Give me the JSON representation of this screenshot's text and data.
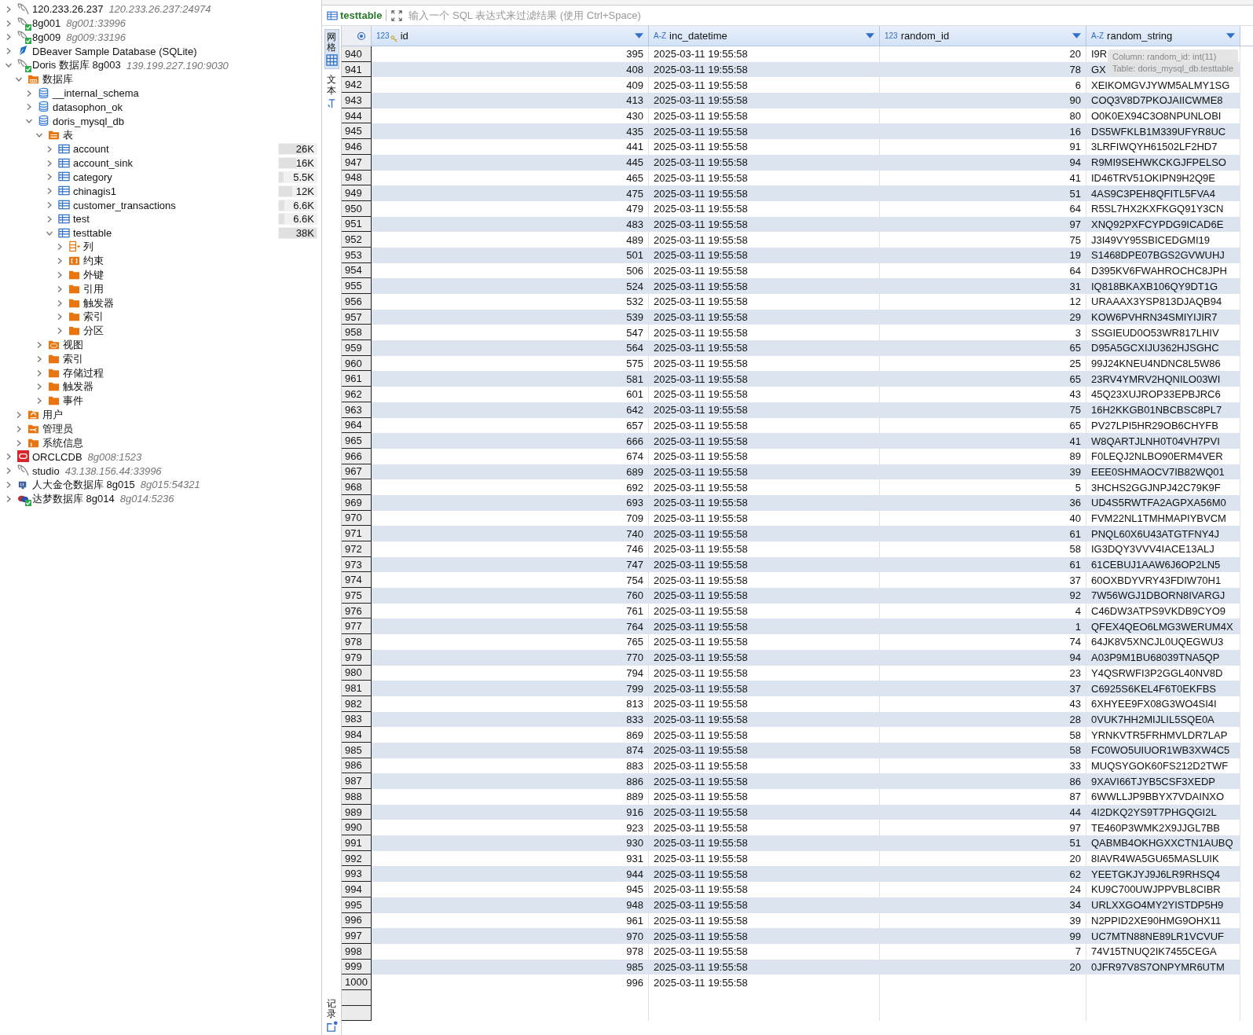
{
  "tree": [
    {
      "label": "120.233.26.237",
      "detail": "120.233.26.237:24974",
      "kind": "server",
      "connected": false,
      "expanded": false
    },
    {
      "label": "8g001",
      "detail": "8g001:33996",
      "kind": "server",
      "connected": true,
      "expanded": false
    },
    {
      "label": "8g009",
      "detail": "8g009:33196",
      "kind": "server",
      "connected": true,
      "expanded": false
    },
    {
      "label": "DBeaver Sample Database (SQLite)",
      "kind": "sqlite",
      "connected": false,
      "expanded": false
    },
    {
      "label": "Doris 数据库 8g003",
      "detail": "139.199.227.190:9030",
      "kind": "server",
      "connected": true,
      "expanded": true,
      "children": [
        {
          "label": "数据库",
          "kind": "databases",
          "expanded": true,
          "children": [
            {
              "label": "__internal_schema",
              "kind": "schema",
              "expanded": false
            },
            {
              "label": "datasophon_ok",
              "kind": "schema",
              "expanded": false
            },
            {
              "label": "doris_mysql_db",
              "kind": "schema",
              "expanded": true,
              "children": [
                {
                  "label": "表",
                  "kind": "tables",
                  "expanded": true,
                  "children": [
                    {
                      "label": "account",
                      "kind": "table",
                      "expanded": false,
                      "size": "26K",
                      "level": 0.7
                    },
                    {
                      "label": "account_sink",
                      "kind": "table",
                      "expanded": false,
                      "size": "16K",
                      "level": 0.45
                    },
                    {
                      "label": "category",
                      "kind": "table",
                      "expanded": false,
                      "size": "5.5K",
                      "level": 0.12
                    },
                    {
                      "label": "chinagis1",
                      "kind": "table",
                      "expanded": false,
                      "size": "12K",
                      "level": 0.35
                    },
                    {
                      "label": "customer_transactions",
                      "kind": "table",
                      "expanded": false,
                      "size": "6.6K",
                      "level": 0.15
                    },
                    {
                      "label": "test",
                      "kind": "table",
                      "expanded": false,
                      "size": "6.6K",
                      "level": 0.15
                    },
                    {
                      "label": "testtable",
                      "kind": "table",
                      "expanded": true,
                      "size": "38K",
                      "level": 1,
                      "children": [
                        {
                          "label": "列",
                          "kind": "columns",
                          "expanded": false
                        },
                        {
                          "label": "约束",
                          "kind": "constraints",
                          "expanded": false
                        },
                        {
                          "label": "外键",
                          "kind": "folder",
                          "expanded": false
                        },
                        {
                          "label": "引用",
                          "kind": "folder",
                          "expanded": false
                        },
                        {
                          "label": "触发器",
                          "kind": "folder",
                          "expanded": false
                        },
                        {
                          "label": "索引",
                          "kind": "folder",
                          "expanded": false
                        },
                        {
                          "label": "分区",
                          "kind": "folder",
                          "expanded": false
                        }
                      ]
                    }
                  ]
                },
                {
                  "label": "视图",
                  "kind": "views",
                  "expanded": false
                },
                {
                  "label": "索引",
                  "kind": "folder",
                  "expanded": false
                },
                {
                  "label": "存储过程",
                  "kind": "folder",
                  "expanded": false
                },
                {
                  "label": "触发器",
                  "kind": "folder",
                  "expanded": false
                },
                {
                  "label": "事件",
                  "kind": "folder",
                  "expanded": false
                }
              ]
            }
          ]
        },
        {
          "label": "用户",
          "kind": "users",
          "expanded": false
        },
        {
          "label": "管理员",
          "kind": "admins",
          "expanded": false
        },
        {
          "label": "系统信息",
          "kind": "info",
          "expanded": false
        }
      ]
    },
    {
      "label": "ORCLCDB",
      "detail": "8g008:1523",
      "kind": "oracle",
      "connected": false,
      "expanded": false
    },
    {
      "label": "studio",
      "detail": "43.138.156.44:33996",
      "kind": "server",
      "connected": false,
      "expanded": false
    },
    {
      "label": "人大金仓数据库 8g015",
      "detail": "8g015:54321",
      "kind": "kingbase",
      "connected": false,
      "expanded": false
    },
    {
      "label": "达梦数据库 8g014",
      "detail": "8g014:5236",
      "kind": "dameng",
      "connected": true,
      "expanded": false
    }
  ],
  "filter": {
    "table": "testtable",
    "placeholder": "输入一个 SQL 表达式来过滤结果 (使用 Ctrl+Space)"
  },
  "side_tabs": [
    {
      "label": "网格",
      "kind": "grid",
      "selected": true
    },
    {
      "label": "文本",
      "kind": "text",
      "selected": false
    }
  ],
  "record_tab": {
    "label": "记录"
  },
  "columns": [
    {
      "type": "123",
      "name": "id",
      "key": true
    },
    {
      "type": "A-Z",
      "name": "inc_datetime",
      "key": false
    },
    {
      "type": "123",
      "name": "random_id",
      "key": false
    },
    {
      "type": "A-Z",
      "name": "random_string",
      "key": false
    }
  ],
  "rows": [
    {
      "row": "940",
      "id": "395",
      "datetime": "2025-03-11 19:55:58",
      "random_id": "20",
      "random_string": "I9R"
    },
    {
      "row": "941",
      "id": "408",
      "datetime": "2025-03-11 19:55:58",
      "random_id": "78",
      "random_string": "GX"
    },
    {
      "row": "942",
      "id": "409",
      "datetime": "2025-03-11 19:55:58",
      "random_id": "6",
      "random_string": "XEIKOMGVJYWM5ALMY1SG"
    },
    {
      "row": "943",
      "id": "413",
      "datetime": "2025-03-11 19:55:58",
      "random_id": "90",
      "random_string": "COQ3V8D7PKOJAIICWME8"
    },
    {
      "row": "944",
      "id": "430",
      "datetime": "2025-03-11 19:55:58",
      "random_id": "80",
      "random_string": "O0K0EX94C3O8NPUNLOBI"
    },
    {
      "row": "945",
      "id": "435",
      "datetime": "2025-03-11 19:55:58",
      "random_id": "16",
      "random_string": "DS5WFKLB1M339UFYR8UC"
    },
    {
      "row": "946",
      "id": "441",
      "datetime": "2025-03-11 19:55:58",
      "random_id": "91",
      "random_string": "3LRFIWQYH61502LF2HD7"
    },
    {
      "row": "947",
      "id": "445",
      "datetime": "2025-03-11 19:55:58",
      "random_id": "94",
      "random_string": "R9MI9SEHWKCKGJFPELSO"
    },
    {
      "row": "948",
      "id": "465",
      "datetime": "2025-03-11 19:55:58",
      "random_id": "41",
      "random_string": "ID46TRV51OKIPN9H2Q9E"
    },
    {
      "row": "949",
      "id": "475",
      "datetime": "2025-03-11 19:55:58",
      "random_id": "51",
      "random_string": "4AS9C3PEH8QFITL5FVA4"
    },
    {
      "row": "950",
      "id": "479",
      "datetime": "2025-03-11 19:55:58",
      "random_id": "64",
      "random_string": "R5SL7HX2KXFKGQ91Y3CN"
    },
    {
      "row": "951",
      "id": "483",
      "datetime": "2025-03-11 19:55:58",
      "random_id": "97",
      "random_string": "XNQ92PXFCYPDG9ICAD6E"
    },
    {
      "row": "952",
      "id": "489",
      "datetime": "2025-03-11 19:55:58",
      "random_id": "75",
      "random_string": "J3I49VY95SBICEDGMI19"
    },
    {
      "row": "953",
      "id": "501",
      "datetime": "2025-03-11 19:55:58",
      "random_id": "19",
      "random_string": "S1468DPE07BGS2GVWUHJ"
    },
    {
      "row": "954",
      "id": "506",
      "datetime": "2025-03-11 19:55:58",
      "random_id": "64",
      "random_string": "D395KV6FWAHROCHC8JPH"
    },
    {
      "row": "955",
      "id": "524",
      "datetime": "2025-03-11 19:55:58",
      "random_id": "31",
      "random_string": "IQ818BKAXB106QY9DT1G"
    },
    {
      "row": "956",
      "id": "532",
      "datetime": "2025-03-11 19:55:58",
      "random_id": "12",
      "random_string": "URAAAX3YSP813DJAQB94"
    },
    {
      "row": "957",
      "id": "539",
      "datetime": "2025-03-11 19:55:58",
      "random_id": "29",
      "random_string": "KOW6PVHRN34SMIYIJIR7"
    },
    {
      "row": "958",
      "id": "547",
      "datetime": "2025-03-11 19:55:58",
      "random_id": "3",
      "random_string": "SSGIEUD0O53WR817LHIV"
    },
    {
      "row": "959",
      "id": "564",
      "datetime": "2025-03-11 19:55:58",
      "random_id": "65",
      "random_string": "D95A5GCXIJU362HJSGHC"
    },
    {
      "row": "960",
      "id": "575",
      "datetime": "2025-03-11 19:55:58",
      "random_id": "25",
      "random_string": "99J24KNEU4NDNC8L5W86"
    },
    {
      "row": "961",
      "id": "581",
      "datetime": "2025-03-11 19:55:58",
      "random_id": "65",
      "random_string": "23RV4YMRV2HQNILO03WI"
    },
    {
      "row": "962",
      "id": "601",
      "datetime": "2025-03-11 19:55:58",
      "random_id": "43",
      "random_string": "45Q23XUJROP33EPBJRC6"
    },
    {
      "row": "963",
      "id": "642",
      "datetime": "2025-03-11 19:55:58",
      "random_id": "75",
      "random_string": "16H2KKGB01NBCBSC8PL7"
    },
    {
      "row": "964",
      "id": "657",
      "datetime": "2025-03-11 19:55:58",
      "random_id": "65",
      "random_string": "PV27LPI5HR29OB6CHYFB"
    },
    {
      "row": "965",
      "id": "666",
      "datetime": "2025-03-11 19:55:58",
      "random_id": "41",
      "random_string": "W8QARTJLNH0T04VH7PVI"
    },
    {
      "row": "966",
      "id": "674",
      "datetime": "2025-03-11 19:55:58",
      "random_id": "89",
      "random_string": "F0LEQJ2NLBO90ERM4VER"
    },
    {
      "row": "967",
      "id": "689",
      "datetime": "2025-03-11 19:55:58",
      "random_id": "39",
      "random_string": "EEE0SHMAOCV7IB82WQ01"
    },
    {
      "row": "968",
      "id": "692",
      "datetime": "2025-03-11 19:55:58",
      "random_id": "5",
      "random_string": "3HCHS2GGJNPJ42C79K9F"
    },
    {
      "row": "969",
      "id": "693",
      "datetime": "2025-03-11 19:55:58",
      "random_id": "36",
      "random_string": "UD4S5RWTFA2AGPXA56M0"
    },
    {
      "row": "970",
      "id": "709",
      "datetime": "2025-03-11 19:55:58",
      "random_id": "40",
      "random_string": "FVM22NL1TMHMAPIYBVCM"
    },
    {
      "row": "971",
      "id": "740",
      "datetime": "2025-03-11 19:55:58",
      "random_id": "61",
      "random_string": "PNQL60X6U43ATGTFNY4J"
    },
    {
      "row": "972",
      "id": "746",
      "datetime": "2025-03-11 19:55:58",
      "random_id": "58",
      "random_string": "IG3DQY3VVV4IACE13ALJ"
    },
    {
      "row": "973",
      "id": "747",
      "datetime": "2025-03-11 19:55:58",
      "random_id": "61",
      "random_string": "61CEBUJ1AAW6J6OP2LN5"
    },
    {
      "row": "974",
      "id": "754",
      "datetime": "2025-03-11 19:55:58",
      "random_id": "37",
      "random_string": "60OXBDYVRY43FDIW70H1"
    },
    {
      "row": "975",
      "id": "760",
      "datetime": "2025-03-11 19:55:58",
      "random_id": "92",
      "random_string": "7W56WGJ1DBORN8IVARGJ"
    },
    {
      "row": "976",
      "id": "761",
      "datetime": "2025-03-11 19:55:58",
      "random_id": "4",
      "random_string": "C46DW3ATPS9VKDB9CYO9"
    },
    {
      "row": "977",
      "id": "764",
      "datetime": "2025-03-11 19:55:58",
      "random_id": "1",
      "random_string": "QFEX4QEO6LMG3WERUM4X"
    },
    {
      "row": "978",
      "id": "765",
      "datetime": "2025-03-11 19:55:58",
      "random_id": "74",
      "random_string": "64JK8V5XNCJL0UQEGWU3"
    },
    {
      "row": "979",
      "id": "770",
      "datetime": "2025-03-11 19:55:58",
      "random_id": "94",
      "random_string": "A03P9M1BU68039TNA5QP"
    },
    {
      "row": "980",
      "id": "794",
      "datetime": "2025-03-11 19:55:58",
      "random_id": "23",
      "random_string": "Y4QSRWFI3P2GGL40NV8D"
    },
    {
      "row": "981",
      "id": "799",
      "datetime": "2025-03-11 19:55:58",
      "random_id": "37",
      "random_string": "C6925S6KEL4F6T0EKFBS"
    },
    {
      "row": "982",
      "id": "813",
      "datetime": "2025-03-11 19:55:58",
      "random_id": "43",
      "random_string": "6XHYEE9FX08G3WO4SI4I"
    },
    {
      "row": "983",
      "id": "833",
      "datetime": "2025-03-11 19:55:58",
      "random_id": "28",
      "random_string": "0VUK7HH2MIJLIL5SQE0A"
    },
    {
      "row": "984",
      "id": "869",
      "datetime": "2025-03-11 19:55:58",
      "random_id": "58",
      "random_string": "YRNKVTR5FRHMVLDR7LAP"
    },
    {
      "row": "985",
      "id": "874",
      "datetime": "2025-03-11 19:55:58",
      "random_id": "58",
      "random_string": "FC0WO5UIUOR1WB3XW4C5"
    },
    {
      "row": "986",
      "id": "883",
      "datetime": "2025-03-11 19:55:58",
      "random_id": "33",
      "random_string": "MUQSYGOK60FS212D2TWF"
    },
    {
      "row": "987",
      "id": "886",
      "datetime": "2025-03-11 19:55:58",
      "random_id": "86",
      "random_string": "9XAVI66TJYB5CSF3XEDP"
    },
    {
      "row": "988",
      "id": "889",
      "datetime": "2025-03-11 19:55:58",
      "random_id": "87",
      "random_string": "6WWLLJP9BBYX7VDAINXO"
    },
    {
      "row": "989",
      "id": "916",
      "datetime": "2025-03-11 19:55:58",
      "random_id": "44",
      "random_string": "4I2DKQ2YS9T7PHGQGI2L"
    },
    {
      "row": "990",
      "id": "923",
      "datetime": "2025-03-11 19:55:58",
      "random_id": "97",
      "random_string": "TE460P3WMK2X9JJGL7BB"
    },
    {
      "row": "991",
      "id": "930",
      "datetime": "2025-03-11 19:55:58",
      "random_id": "51",
      "random_string": "QABMB4OKHGXXCTN1AUBQ"
    },
    {
      "row": "992",
      "id": "931",
      "datetime": "2025-03-11 19:55:58",
      "random_id": "20",
      "random_string": "8IAVR4WA5GU65MASLUIK"
    },
    {
      "row": "993",
      "id": "944",
      "datetime": "2025-03-11 19:55:58",
      "random_id": "62",
      "random_string": "YEETGKJYJ9J6LR9RHSQ4"
    },
    {
      "row": "994",
      "id": "945",
      "datetime": "2025-03-11 19:55:58",
      "random_id": "24",
      "random_string": "KU9C700UWJPPVBL8CIBR"
    },
    {
      "row": "995",
      "id": "948",
      "datetime": "2025-03-11 19:55:58",
      "random_id": "34",
      "random_string": "URLXXGO4MY2YISTDP5H9"
    },
    {
      "row": "996",
      "id": "961",
      "datetime": "2025-03-11 19:55:58",
      "random_id": "39",
      "random_string": "N2PPID2XE90HMG9OHX11"
    },
    {
      "row": "997",
      "id": "970",
      "datetime": "2025-03-11 19:55:58",
      "random_id": "99",
      "random_string": "UC7MTN88NE89LR1VCVUF"
    },
    {
      "row": "998",
      "id": "978",
      "datetime": "2025-03-11 19:55:58",
      "random_id": "7",
      "random_string": "74V15TNUQ2IK7455CEGA"
    },
    {
      "row": "999",
      "id": "985",
      "datetime": "2025-03-11 19:55:58",
      "random_id": "20",
      "random_string": "0JFR97V8S7ONPYMR6UTM"
    },
    {
      "row": "1000",
      "id": "996",
      "datetime": "2025-03-11 19:55:58"
    }
  ],
  "tooltip": {
    "lines": [
      "Column: random_id: int(11)",
      "Table: doris_mysql_db.testtable"
    ]
  }
}
